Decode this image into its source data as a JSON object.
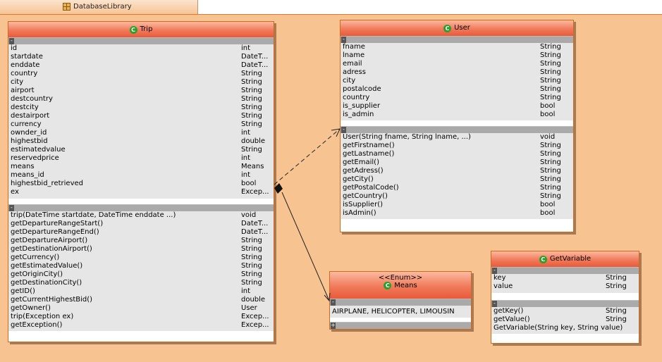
{
  "tab": {
    "label": "DatabaseLibrary"
  },
  "classes": {
    "trip": {
      "name": "Trip",
      "attributes": [
        {
          "n": "id",
          "t": "int"
        },
        {
          "n": "startdate",
          "t": "DateT..."
        },
        {
          "n": "enddate",
          "t": "DateT..."
        },
        {
          "n": "country",
          "t": "String"
        },
        {
          "n": "city",
          "t": "String"
        },
        {
          "n": "airport",
          "t": "String"
        },
        {
          "n": "destcountry",
          "t": "String"
        },
        {
          "n": "destcity",
          "t": "String"
        },
        {
          "n": "destairport",
          "t": "String"
        },
        {
          "n": "currency",
          "t": "String"
        },
        {
          "n": "ownder_id",
          "t": "int"
        },
        {
          "n": "highestbid",
          "t": "double"
        },
        {
          "n": "estimatedvalue",
          "t": "String"
        },
        {
          "n": "reservedprice",
          "t": "int"
        },
        {
          "n": "means",
          "t": "Means"
        },
        {
          "n": "means_id",
          "t": "int"
        },
        {
          "n": "highestbid_retrieved",
          "t": "bool"
        },
        {
          "n": "ex",
          "t": "Excep..."
        }
      ],
      "methods": [
        {
          "n": "trip(DateTime startdate, DateTime enddate ...)",
          "t": "void"
        },
        {
          "n": "getDepartureRangeStart()",
          "t": "DateT..."
        },
        {
          "n": "getDepartureRangeEnd()",
          "t": "DateT..."
        },
        {
          "n": "getDepartureAirport()",
          "t": "String"
        },
        {
          "n": "getDestinationAirport()",
          "t": "String"
        },
        {
          "n": "getCurrency()",
          "t": "String"
        },
        {
          "n": "getEstimatedValue()",
          "t": "String"
        },
        {
          "n": "getOriginCity()",
          "t": "String"
        },
        {
          "n": "getDestinationCity()",
          "t": "String"
        },
        {
          "n": "getID()",
          "t": "int"
        },
        {
          "n": "getCurrentHighestBid()",
          "t": "double"
        },
        {
          "n": "getOwner()",
          "t": "User"
        },
        {
          "n": "trip(Exception ex)",
          "t": "Excep..."
        },
        {
          "n": "getException()",
          "t": "Excep..."
        }
      ]
    },
    "user": {
      "name": "User",
      "attributes": [
        {
          "n": "fname",
          "t": "String"
        },
        {
          "n": "lname",
          "t": "String"
        },
        {
          "n": "email",
          "t": "String"
        },
        {
          "n": "adress",
          "t": "String"
        },
        {
          "n": "city",
          "t": "String"
        },
        {
          "n": "postalcode",
          "t": "String"
        },
        {
          "n": "country",
          "t": "String"
        },
        {
          "n": "is_supplier",
          "t": "bool"
        },
        {
          "n": "is_admin",
          "t": "bool"
        }
      ],
      "methods": [
        {
          "n": "User(String fname, String lname, ...)",
          "t": "void"
        },
        {
          "n": "getFirstname()",
          "t": "String"
        },
        {
          "n": "getLastname()",
          "t": "String"
        },
        {
          "n": "getEmail()",
          "t": "String"
        },
        {
          "n": "getAdress()",
          "t": "String"
        },
        {
          "n": "getCity()",
          "t": "String"
        },
        {
          "n": "getPostalCode()",
          "t": "String"
        },
        {
          "n": "getCountry()",
          "t": "String"
        },
        {
          "n": "isSupplier()",
          "t": "bool"
        },
        {
          "n": "isAdmin()",
          "t": "bool"
        }
      ]
    },
    "means": {
      "stereotype": "<<Enum>>",
      "name": "Means",
      "values": "AIRPLANE, HELICOPTER, LIMOUSIN"
    },
    "getvariable": {
      "name": "GetVariable",
      "attributes": [
        {
          "n": "key",
          "t": "String"
        },
        {
          "n": "value",
          "t": "String"
        }
      ],
      "methods": [
        {
          "n": "getKey()",
          "t": "String"
        },
        {
          "n": "getValue()",
          "t": "String"
        },
        {
          "n": "GetVariable(String key, String value)",
          "t": ""
        }
      ]
    }
  },
  "icons": {
    "class_icon": "class-c-icon",
    "tab_icon": "grid-package-icon",
    "collapse_toggle": "minus-toggle-icon",
    "expand_toggle": "plus-toggle-icon"
  },
  "colors": {
    "canvas": "#f7c491",
    "header": "#f07a5a",
    "border": "#d26a1c",
    "section": "#e6e6e6",
    "class_icon": "#2aa02a"
  }
}
